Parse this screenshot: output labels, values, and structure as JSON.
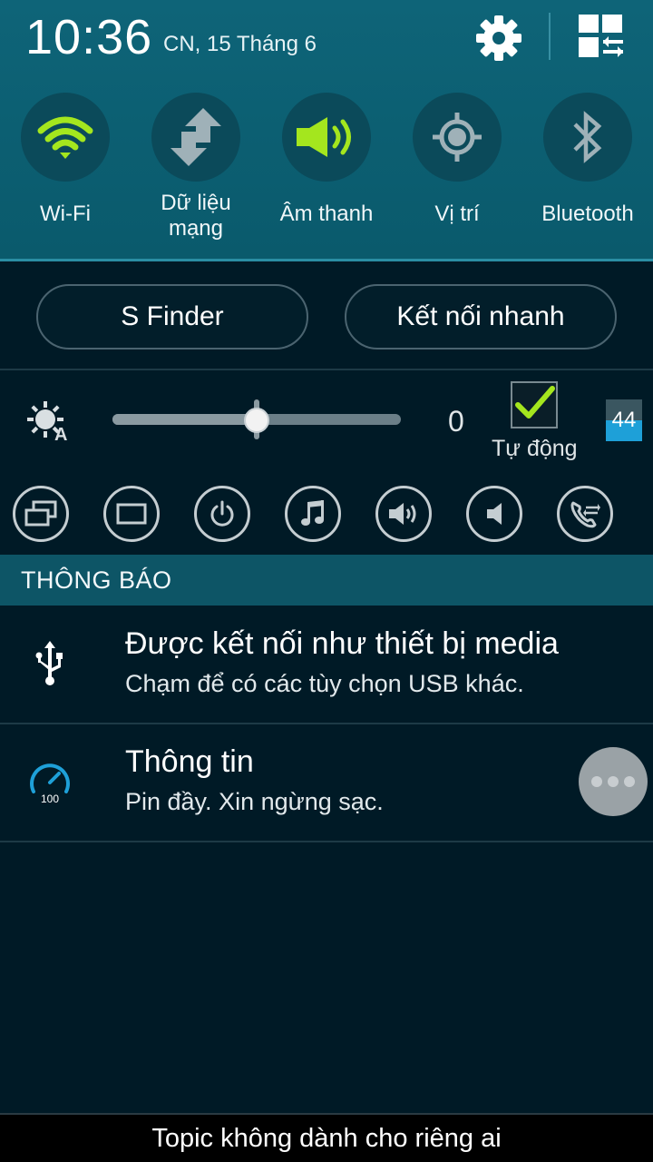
{
  "status": {
    "time": "10:36",
    "date": "CN, 15 Tháng 6"
  },
  "header_icons": {
    "settings": "gear-icon",
    "edit": "grid-edit-icon"
  },
  "quick_toggles": [
    {
      "label": "Wi-Fi",
      "icon": "wifi-icon",
      "active": true
    },
    {
      "label": "Dữ liệu mạng",
      "line1": "Dữ liệu",
      "line2": "mạng",
      "icon": "mobile-data-icon",
      "active": false
    },
    {
      "label": "Âm thanh",
      "icon": "sound-icon",
      "active": true
    },
    {
      "label": "Vị trí",
      "icon": "location-icon",
      "active": false
    },
    {
      "label": "Bluetooth",
      "icon": "bluetooth-icon",
      "active": false
    }
  ],
  "buttons": {
    "s_finder": "S Finder",
    "quick_connect": "Kết nối nhanh"
  },
  "brightness": {
    "value": "0",
    "level": 0.5,
    "auto_label": "Tự động",
    "auto_checked": true,
    "badge": "44"
  },
  "mode_icons": [
    "multi-window-icon",
    "screen-mirroring-icon",
    "power-icon",
    "music-icon",
    "volume-icon",
    "mute-icon",
    "call-forward-icon"
  ],
  "notifications_header": "THÔNG BÁO",
  "notifications": [
    {
      "title": "Được kết nối như thiết bị media",
      "subtitle": "Chạm để có các tùy chọn USB khác.",
      "icon": "usb-icon"
    },
    {
      "title": "Thông tin",
      "subtitle": "Pin đầy.  Xin ngừng sạc.",
      "icon": "battery-gauge-icon",
      "gauge_text": "100"
    }
  ],
  "footer_text": "Topic không dành cho riêng ai",
  "colors": {
    "accent_green": "#a4e61e",
    "header_bg": "#0e6478",
    "panel_bg": "#001a26",
    "notif_header_bg": "#0d5566"
  }
}
